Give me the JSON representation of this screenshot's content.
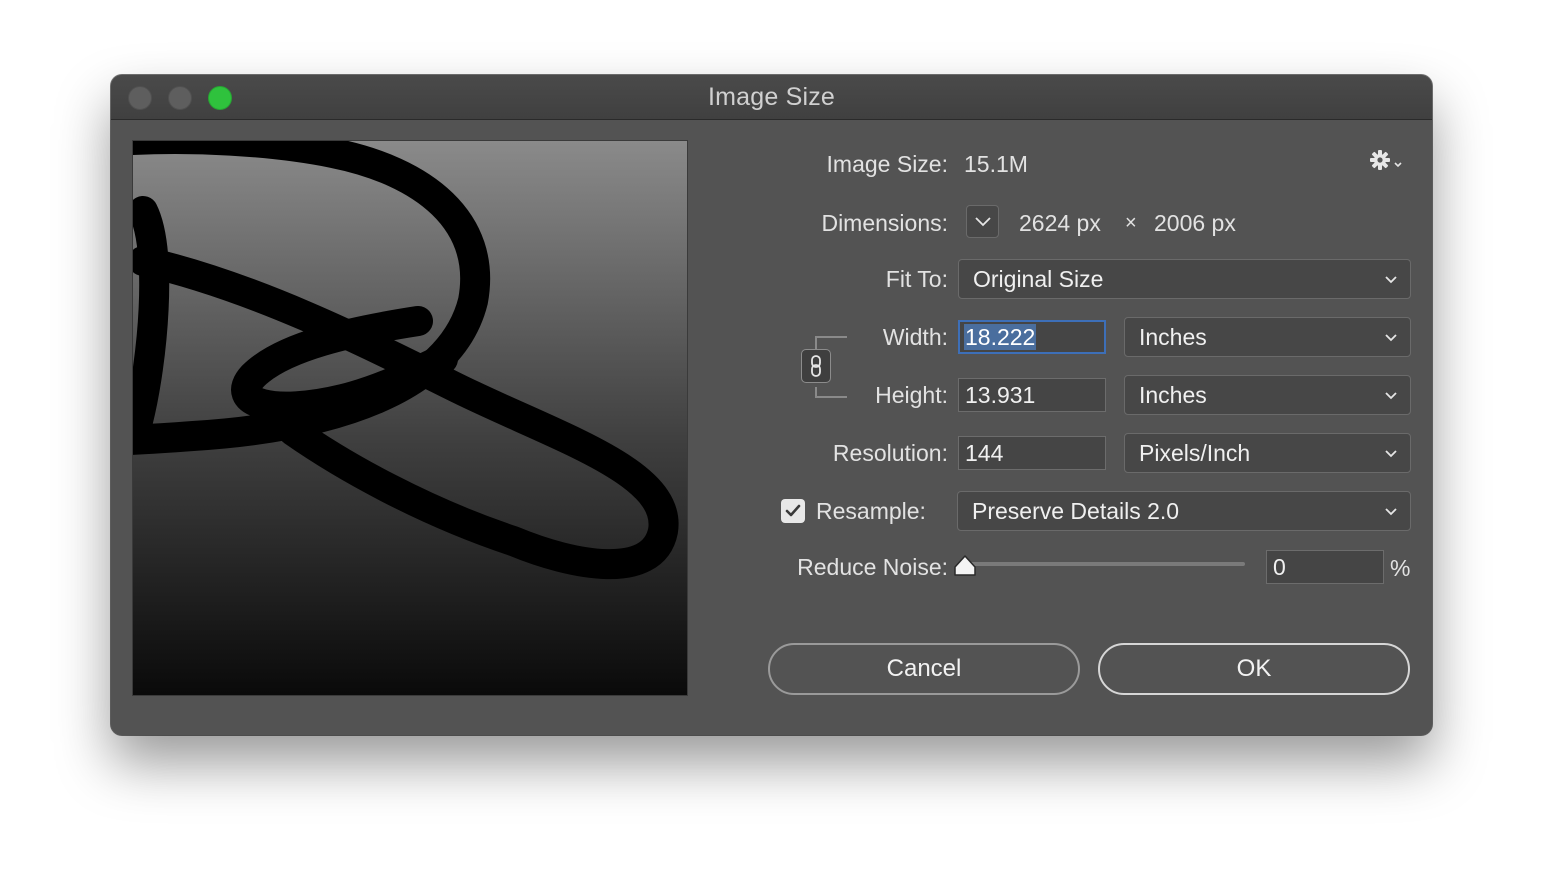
{
  "window": {
    "title": "Image Size",
    "traffic_lights": {
      "close": "#5e5e5e",
      "minimize": "#5e5e5e",
      "zoom": "#2fc23d"
    }
  },
  "image_size": {
    "label": "Image Size:",
    "value": "15.1M"
  },
  "settings_icon": "gear-icon",
  "dimensions": {
    "label": "Dimensions:",
    "width_value": "2624 px",
    "separator": "×",
    "height_value": "2006 px"
  },
  "fit_to": {
    "label": "Fit To:",
    "selected": "Original Size"
  },
  "width": {
    "label": "Width:",
    "value": "18.222",
    "unit": "Inches"
  },
  "height": {
    "label": "Height:",
    "value": "13.931",
    "unit": "Inches"
  },
  "resolution": {
    "label": "Resolution:",
    "value": "144",
    "unit": "Pixels/Inch"
  },
  "resample": {
    "label": "Resample:",
    "checked": true,
    "selected": "Preserve Details 2.0"
  },
  "reduce_noise": {
    "label": "Reduce Noise:",
    "value": "0",
    "unit": "%",
    "level": 0
  },
  "buttons": {
    "cancel": "Cancel",
    "ok": "OK"
  },
  "colors": {
    "selection": "#4a6e9e",
    "focus_ring": "#3d6fb8",
    "dialog_bg": "#535353"
  }
}
